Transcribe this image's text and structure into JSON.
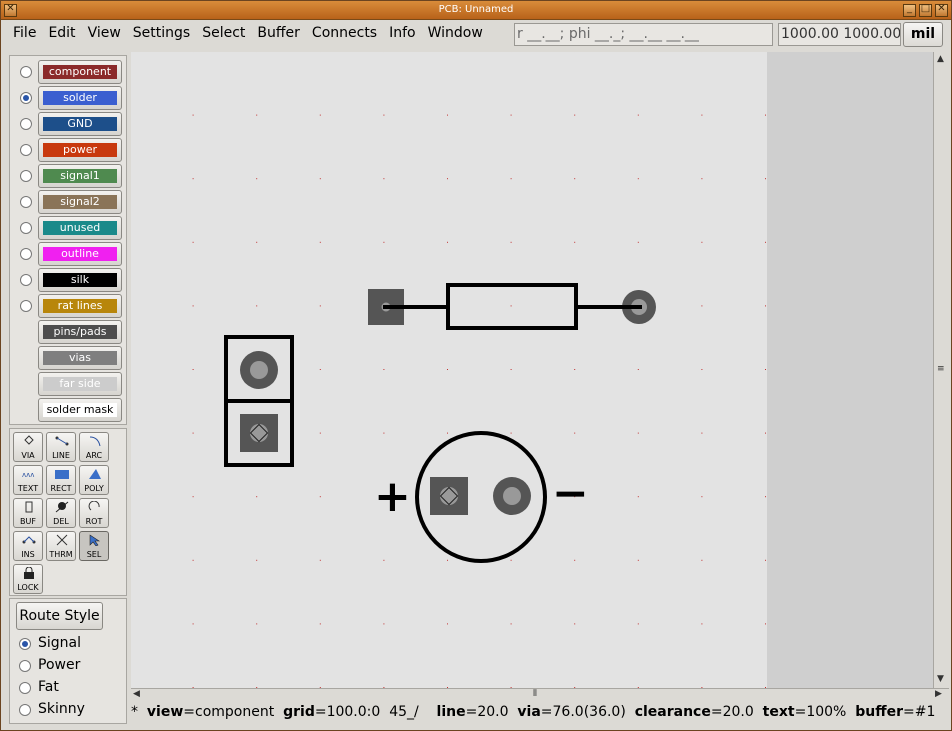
{
  "window": {
    "title": "PCB: Unnamed"
  },
  "menu": [
    "File",
    "Edit",
    "View",
    "Settings",
    "Select",
    "Buffer",
    "Connects",
    "Info",
    "Window"
  ],
  "cursor_readout": "r __.__; phi __._; __.__ __.__",
  "coord_readout": "1000.00 1000.00",
  "unit_button": "mil",
  "layers": [
    {
      "label": "component",
      "color": "#8b2a2a",
      "text_color": "#ffffff",
      "selected": false,
      "has_radio": true
    },
    {
      "label": "solder",
      "color": "#3b5fd0",
      "text_color": "#ffffff",
      "selected": true,
      "has_radio": true
    },
    {
      "label": "GND",
      "color": "#1d4f8a",
      "text_color": "#ffffff",
      "selected": false,
      "has_radio": true
    },
    {
      "label": "power",
      "color": "#c8390e",
      "text_color": "#ffffff",
      "selected": false,
      "has_radio": true
    },
    {
      "label": "signal1",
      "color": "#4f8a4f",
      "text_color": "#ffffff",
      "selected": false,
      "has_radio": true
    },
    {
      "label": "signal2",
      "color": "#8a7458",
      "text_color": "#ffffff",
      "selected": false,
      "has_radio": true
    },
    {
      "label": "unused",
      "color": "#1a8a8a",
      "text_color": "#ffffff",
      "selected": false,
      "has_radio": true
    },
    {
      "label": "outline",
      "color": "#f020f0",
      "text_color": "#ffffff",
      "selected": false,
      "has_radio": true
    },
    {
      "label": "silk",
      "color": "#000000",
      "text_color": "#ffffff",
      "selected": false,
      "has_radio": true
    },
    {
      "label": "rat lines",
      "color": "#b8860b",
      "text_color": "#ffffff",
      "selected": false,
      "has_radio": true
    },
    {
      "label": "pins/pads",
      "color": "#4d4d4d",
      "text_color": "#ffffff",
      "selected": false,
      "has_radio": false
    },
    {
      "label": "vias",
      "color": "#7f7f7f",
      "text_color": "#ffffff",
      "selected": false,
      "has_radio": false
    },
    {
      "label": "far side",
      "color": "#cccccc",
      "text_color": "#ffffff",
      "selected": false,
      "has_radio": false
    },
    {
      "label": "solder mask",
      "color": "#ffffff",
      "text_color": "#000000",
      "selected": false,
      "has_radio": false
    }
  ],
  "tools": [
    {
      "label": "VIA",
      "icon": "via-icon"
    },
    {
      "label": "LINE",
      "icon": "line-icon"
    },
    {
      "label": "ARC",
      "icon": "arc-icon"
    },
    {
      "label": "TEXT",
      "icon": "text-icon"
    },
    {
      "label": "RECT",
      "icon": "rect-icon"
    },
    {
      "label": "POLY",
      "icon": "poly-icon"
    },
    {
      "label": "BUF",
      "icon": "buffer-icon"
    },
    {
      "label": "DEL",
      "icon": "delete-icon"
    },
    {
      "label": "ROT",
      "icon": "rotate-icon"
    },
    {
      "label": "INS",
      "icon": "insert-icon"
    },
    {
      "label": "THRM",
      "icon": "thermal-icon"
    },
    {
      "label": "SEL",
      "icon": "select-icon",
      "active": true
    },
    {
      "label": "LOCK",
      "icon": "lock-icon"
    }
  ],
  "route_style": {
    "button": "Route Style",
    "options": [
      {
        "label": "Signal",
        "selected": true
      },
      {
        "label": "Power",
        "selected": false
      },
      {
        "label": "Fat",
        "selected": false
      },
      {
        "label": "Skinny",
        "selected": false
      }
    ]
  },
  "board": {
    "plus_sign": "+",
    "minus_sign": "−"
  },
  "status": {
    "prefix": "*",
    "view_key": "view",
    "view_val": "=component",
    "grid_key": "grid",
    "grid_val": "=100.0:0  45_/",
    "line_key": "line",
    "line_val": "=20.0",
    "via_key": "via",
    "via_val": "=76.0(36.0)",
    "clearance_key": "clearance",
    "clearance_val": "=20.0",
    "text_key": "text",
    "text_val": "=100%",
    "buffer_key": "buffer",
    "buffer_val": "=#1"
  }
}
